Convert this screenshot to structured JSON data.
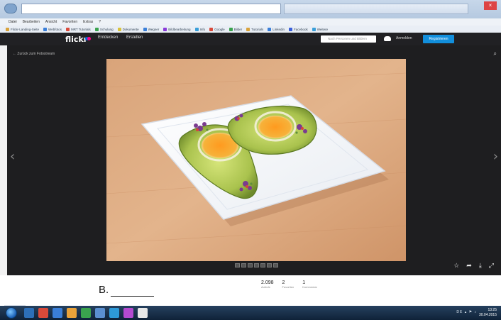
{
  "browser": {
    "address": "",
    "menu": [
      "Datei",
      "Bearbeiten",
      "Ansicht",
      "Favoriten",
      "Extras",
      "?"
    ],
    "favorites": [
      {
        "label": "Flickr-Landing-Seite",
        "color": "#d9a23a"
      },
      {
        "label": "Webfotos",
        "color": "#3a7fd9"
      },
      {
        "label": "MRT Tutorials",
        "color": "#d94a3a"
      },
      {
        "label": "Schulung",
        "color": "#3aa34e"
      },
      {
        "label": "Dokumente",
        "color": "#d9c23a"
      },
      {
        "label": "Wegner",
        "color": "#3a7fd9"
      },
      {
        "label": "Bildbearbeitung",
        "color": "#8a3ad9"
      },
      {
        "label": "Info",
        "color": "#3a9fd9"
      },
      {
        "label": "Google",
        "color": "#d94a3a"
      },
      {
        "label": "Bilder",
        "color": "#3aa34e"
      },
      {
        "label": "Tutorials",
        "color": "#d9a23a"
      },
      {
        "label": "Linkedin",
        "color": "#3a7fd9"
      },
      {
        "label": "Facebook",
        "color": "#3a5fd9"
      },
      {
        "label": "Weitere",
        "color": "#3a9fd9"
      }
    ]
  },
  "flickr": {
    "logo": "flickr",
    "nav": [
      "Entdecken",
      "Erstellen"
    ],
    "search_placeholder": "Nach Personen und Bildern",
    "login": "Anmelden",
    "register": "Registrieren",
    "back_link": "Zurück zum Fotostream",
    "stats": [
      {
        "value": "2.098",
        "label": "Aufrufe"
      },
      {
        "value": "2",
        "label": "Favoriten"
      },
      {
        "value": "1",
        "label": "Kommentar"
      }
    ]
  },
  "icons": {
    "search": "search-icon",
    "zoom": "magnifier-icon",
    "prev": "chevron-left-icon",
    "next": "chevron-right-icon",
    "actions": [
      "star-icon",
      "share-icon",
      "download-icon",
      "fullscreen-icon"
    ]
  },
  "worksheet": {
    "label": "B."
  },
  "taskbar": {
    "tray": "DE ▴ ⚑ ♪",
    "clock_time": "13:25",
    "clock_date": "30.04.2015",
    "apps": [
      "#2d6fb8",
      "#d94a3a",
      "#3a7fd9",
      "#e8a23a",
      "#3aa34e",
      "#5a8fd0",
      "#2d9ad9",
      "#b44ad0",
      "#e8e8e8"
    ]
  }
}
